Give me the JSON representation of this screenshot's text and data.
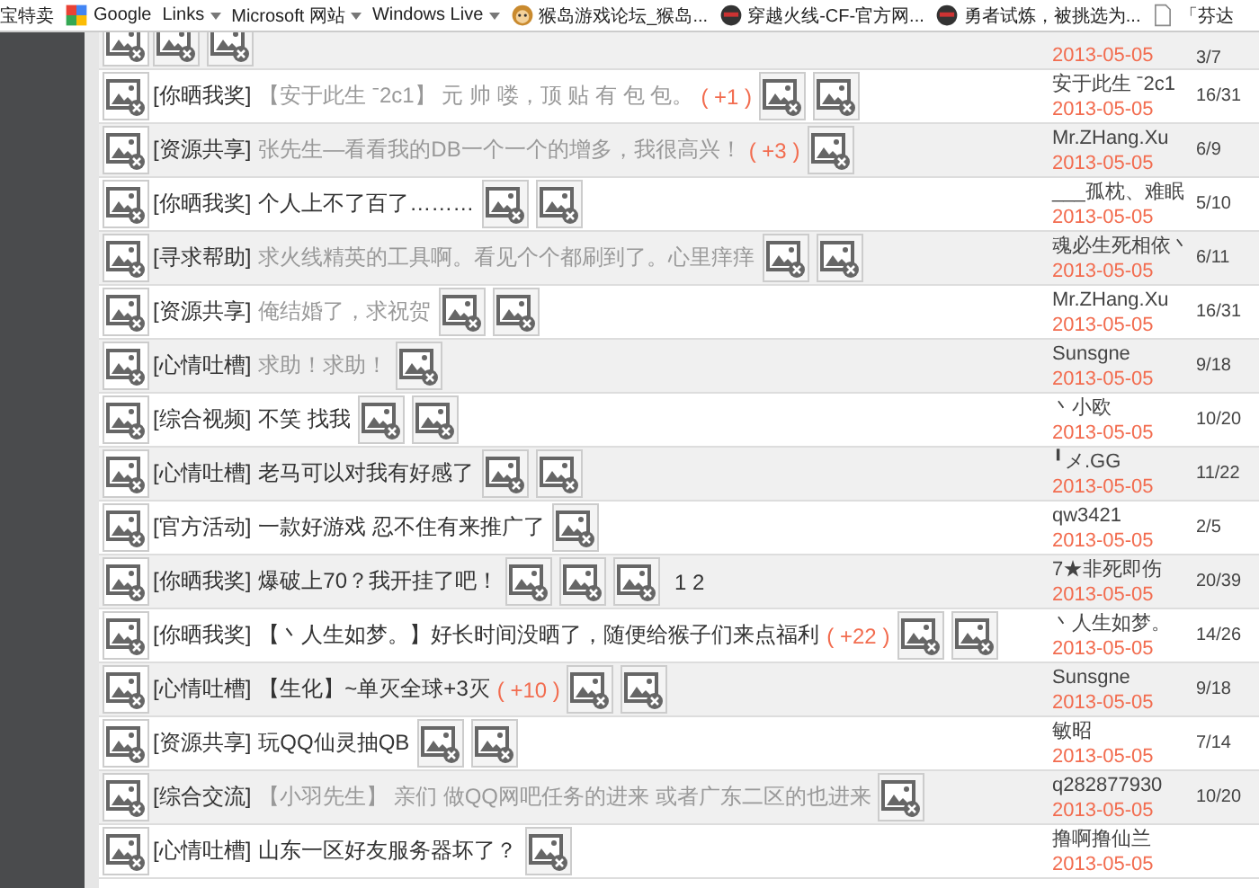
{
  "bookmarks_bar": [
    {
      "label": "宝特卖",
      "dropdown": false
    },
    {
      "label": "Google",
      "dropdown": false
    },
    {
      "label": "Links",
      "dropdown": true
    },
    {
      "label": "Microsoft 网站",
      "dropdown": true
    },
    {
      "label": "Windows Live",
      "dropdown": true
    },
    {
      "label": "猴岛游戏论坛_猴岛...",
      "dropdown": false
    },
    {
      "label": "穿越火线-CF-官方网...",
      "dropdown": false
    },
    {
      "label": "勇者试炼，被挑选为...",
      "dropdown": false
    },
    {
      "label": "「芬达",
      "dropdown": false
    }
  ],
  "threads": [
    {
      "date": "2013-05-05",
      "replies": "3/7"
    },
    {
      "category": "[你晒我奖]",
      "title": "【安于此生 ˉ2c1】 元 帅 喽，顶 贴 有 包 包。",
      "visited": true,
      "bonus": "( +1 )",
      "author": "安于此生 ˉ2c1",
      "date": "2013-05-05",
      "replies": "16/31"
    },
    {
      "category": "[资源共享]",
      "title": "张先生—看看我的DB一个一个的增多，我很高兴！",
      "visited": true,
      "bonus": "( +3 )",
      "author": "Mr.ZHang.Xu",
      "date": "2013-05-05",
      "replies": "6/9"
    },
    {
      "category": "[你晒我奖]",
      "title": "个人上不了百了………",
      "visited": false,
      "author": "___孤枕、难眠",
      "date": "2013-05-05",
      "replies": "5/10"
    },
    {
      "category": "[寻求帮助]",
      "title": "求火线精英的工具啊。看见个个都刷到了。心里痒痒",
      "visited": true,
      "author": "魂必生死相依丶",
      "date": "2013-05-05",
      "replies": "6/11"
    },
    {
      "category": "[资源共享]",
      "title": "俺结婚了，求祝贺",
      "visited": true,
      "author": "Mr.ZHang.Xu",
      "date": "2013-05-05",
      "replies": "16/31"
    },
    {
      "category": "[心情吐槽]",
      "title": "求助！求助！",
      "visited": true,
      "author": "Sunsgne",
      "date": "2013-05-05",
      "replies": "9/18"
    },
    {
      "category": "[综合视频]",
      "title": "不笑 找我",
      "visited": false,
      "author": "丶小欧",
      "date": "2013-05-05",
      "replies": "10/20"
    },
    {
      "category": "[心情吐槽]",
      "title": "老马可以对我有好感了",
      "visited": false,
      "author": "╹メ.GG",
      "date": "2013-05-05",
      "replies": "11/22"
    },
    {
      "category": "[官方活动]",
      "title": "一款好游戏 忍不住有来推广了",
      "visited": false,
      "author": "qw3421",
      "date": "2013-05-05",
      "replies": "2/5"
    },
    {
      "category": "[你晒我奖]",
      "title": "爆破上70？我开挂了吧！",
      "visited": false,
      "pages": "1 2",
      "author": "7★非死即伤",
      "date": "2013-05-05",
      "replies": "20/39"
    },
    {
      "category": "[你晒我奖]",
      "title": "【丶人生如梦。】好长时间没晒了，随便给猴子们来点福利",
      "visited": false,
      "bonus": "( +22 )",
      "author": "丶人生如梦。",
      "date": "2013-05-05",
      "replies": "14/26"
    },
    {
      "category": "[心情吐槽]",
      "title": "【生化】~单灭全球+3灭",
      "visited": false,
      "bonus": "( +10 )",
      "author": "Sunsgne",
      "date": "2013-05-05",
      "replies": "9/18"
    },
    {
      "category": "[资源共享]",
      "title": "玩QQ仙灵抽QB",
      "visited": false,
      "author": "敏昭",
      "date": "2013-05-05",
      "replies": "7/14"
    },
    {
      "category": "[综合交流]",
      "title": "【小羽先生】 亲们 做QQ网吧任务的进来 或者广东二区的也进来",
      "visited": true,
      "author": "q282877930",
      "date": "2013-05-05",
      "replies": "10/20"
    },
    {
      "category": "[心情吐槽]",
      "title": "山东一区好友服务器坏了？",
      "visited": false,
      "author": "撸啊撸仙兰",
      "date": "2013-05-05"
    }
  ]
}
